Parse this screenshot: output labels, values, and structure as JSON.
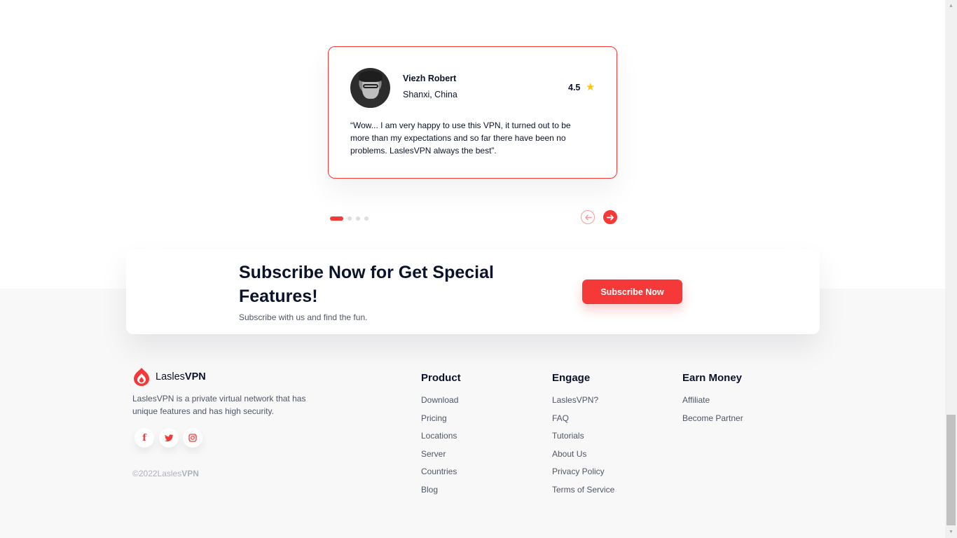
{
  "testimonial": {
    "name": "Viezh Robert",
    "location": "Shanxi, China",
    "rating": "4.5",
    "rating_icon": "star-icon",
    "quote": "“Wow... I am very happy to use this VPN, it turned out to be more than my expectations and so far there have been no problems. LaslesVPN always the best”."
  },
  "slider": {
    "page_count": 4,
    "active_index": 0,
    "prev_icon": "arrow-left-icon",
    "next_icon": "arrow-right-icon"
  },
  "subscribe": {
    "title": "Subscribe Now for Get Special Features!",
    "text": "Subscribe with us and find the fun.",
    "button_label": "Subscribe Now"
  },
  "footer": {
    "brand_light": "Lasles",
    "brand_bold": "VPN",
    "description": "LaslesVPN is a private virtual network that has unique features and has high security.",
    "social": [
      "facebook-icon",
      "twitter-icon",
      "instagram-icon"
    ],
    "copyright_prefix": "©2022Lasles",
    "copyright_bold": "VPN",
    "columns": [
      {
        "title": "Product",
        "links": [
          "Download",
          "Pricing",
          "Locations",
          "Server",
          "Countries",
          "Blog"
        ]
      },
      {
        "title": "Engage",
        "links": [
          "LaslesVPN?",
          "FAQ",
          "Tutorials",
          "About Us",
          "Privacy Policy",
          "Terms of Service"
        ]
      },
      {
        "title": "Earn Money",
        "links": [
          "Affiliate",
          "Become Partner"
        ]
      }
    ]
  },
  "colors": {
    "accent": "#f53838",
    "star": "#fec20e",
    "text_dark": "#0b132a",
    "text_muted": "#4f5665",
    "footer_bg": "#f8f8f8"
  }
}
